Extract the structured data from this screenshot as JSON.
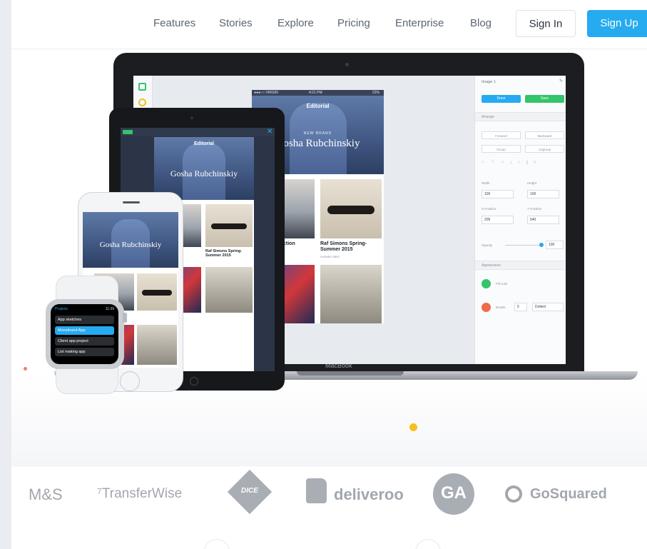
{
  "nav": {
    "links": [
      "Features",
      "Stories",
      "Explore",
      "Pricing",
      "Enterprise",
      "Blog"
    ],
    "sign_in": "Sign In",
    "sign_up": "Sign Up"
  },
  "laptop": {
    "label": "MacBook",
    "phone_mock": {
      "status_left": "●●●○○ VIRGIN",
      "status_time": "4:21 PM",
      "status_right": "22%",
      "title": "Editorial",
      "brand_small": "NEW BRAND",
      "brand": "Gosha Rubchinskiy",
      "caption_left": "ction",
      "caption_right": "Raf Simons Spring-Summer 2015",
      "caption_sub": "SUMMER VIBES"
    },
    "inspector": {
      "title": "Image 1",
      "done": "Done",
      "save": "Save",
      "arrange": "Arrange",
      "forward": "Forward",
      "backward": "Backward",
      "group": "Group",
      "ungroup": "Ungroup",
      "width_label": "Width",
      "height_label": "Height",
      "width": "100",
      "height": "100",
      "x_label": "X Position",
      "y_label": "Y Position",
      "x": "209",
      "y": "540",
      "opacity_label": "Opacity",
      "opacity": "100",
      "appearance": "Appearance",
      "fill_label": "Fill color",
      "border_label": "Border",
      "border_width": "5",
      "border_style": "Dotted"
    }
  },
  "tablet": {
    "title": "Editorial",
    "brand": "Gosha Rubchinskiy",
    "caption_left": "on",
    "caption_right": "Raf Simons Spring-Summer 2015"
  },
  "phone": {
    "brand": "Gosha Rubchinskiy"
  },
  "watch": {
    "header": "Projects",
    "time": "11:39",
    "items": [
      "App sketches",
      "Moneitrand App",
      "Client app project",
      "List making app"
    ]
  },
  "logos": {
    "ms": "M&S",
    "transferwise": "⁷TransferWise",
    "dice": "DICE",
    "deliveroo": "deliveroo",
    "ga": "GA",
    "gosquared": "GoSquared"
  },
  "colors": {
    "accent": "#26aaf0",
    "save_green": "#34c46a",
    "fill_swatch": "#34c46a",
    "border_swatch": "#ef6b4b",
    "dot_yellow": "#f4c021"
  }
}
